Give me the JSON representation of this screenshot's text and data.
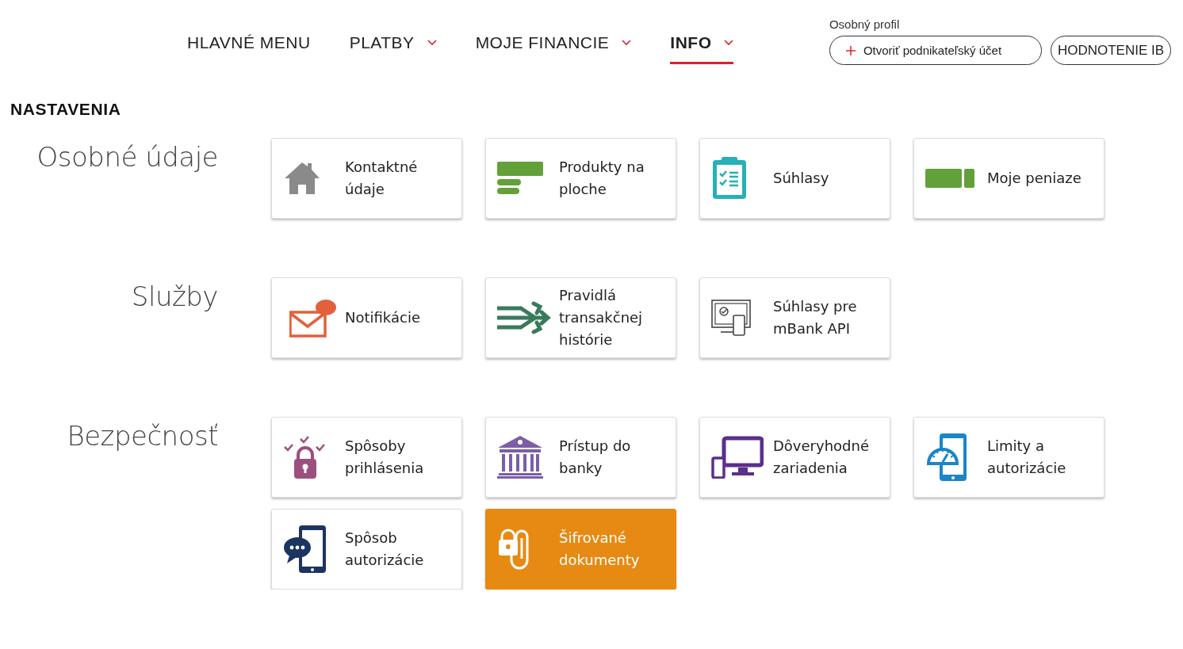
{
  "nav": {
    "items": [
      {
        "label": "HLAVNÉ MENU",
        "has_dropdown": false,
        "selected": false
      },
      {
        "label": "PLATBY",
        "has_dropdown": true,
        "selected": false
      },
      {
        "label": "MOJE FINANCIE",
        "has_dropdown": true,
        "selected": false
      },
      {
        "label": "INFO",
        "has_dropdown": true,
        "selected": true
      }
    ]
  },
  "profile": {
    "title": "Osobný profil",
    "open_account_button": "Otvoriť podnikateľský účet",
    "rating_button": "HODNOTENIE IB"
  },
  "page_title": "NASTAVENIA",
  "sections": [
    {
      "title": "Osobné údaje",
      "tiles": [
        {
          "label": "Kontaktné údaje",
          "kind": "house",
          "highlighted": false
        },
        {
          "label": "Produkty na ploche",
          "kind": "bars",
          "highlighted": false
        },
        {
          "label": "Súhlasy",
          "kind": "clipboard",
          "highlighted": false
        },
        {
          "label": "Moje peniaze",
          "kind": "money",
          "highlighted": false
        }
      ]
    },
    {
      "title": "Služby",
      "tiles": [
        {
          "label": "Notifikácie",
          "kind": "sms",
          "highlighted": false
        },
        {
          "label": "Pravidlá transakčnej histórie",
          "kind": "arrows",
          "highlighted": false
        },
        {
          "label": "Súhlasy pre mBank API",
          "kind": "devices",
          "highlighted": false
        }
      ]
    },
    {
      "title": "Bezpečnosť",
      "tiles": [
        {
          "label": "Spôsoby prihlásenia",
          "kind": "lockchecks",
          "highlighted": false
        },
        {
          "label": "Prístup do banky",
          "kind": "bank",
          "highlighted": false
        },
        {
          "label": "Dôveryhodné zariadenia",
          "kind": "monitor",
          "highlighted": false
        },
        {
          "label": "Limity a autorizácie",
          "kind": "gauge",
          "highlighted": false
        },
        {
          "label": "Spôsob autorizácie",
          "kind": "chat",
          "highlighted": false
        },
        {
          "label": "Šifrované dokumenty",
          "kind": "lockclip",
          "highlighted": true
        }
      ]
    }
  ]
}
